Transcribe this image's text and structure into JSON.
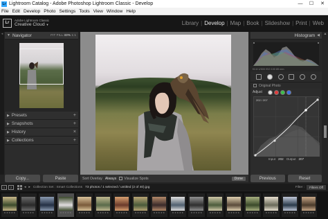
{
  "window": {
    "title": "Lightroom Catalog - Adobe Photoshop Lightroom Classic - Develop",
    "app_icon": "Lr",
    "controls": [
      "minimize-icon",
      "maximize-icon",
      "close-icon"
    ],
    "control_glyphs": [
      "—",
      "☐",
      "✕"
    ]
  },
  "menu": [
    "File",
    "Edit",
    "Develop",
    "Photo",
    "Settings",
    "Tools",
    "View",
    "Window",
    "Help"
  ],
  "identity": {
    "logo": "Lr",
    "line1": "Adobe Lightroom Classic",
    "line2": "Creative Cloud",
    "arrow": "▼"
  },
  "modules": {
    "items": [
      "Library",
      "Develop",
      "Map",
      "Book",
      "Slideshow",
      "Print",
      "Web"
    ],
    "active": "Develop",
    "separator": "|"
  },
  "navigator": {
    "title": "Navigator",
    "zoom_fit": "FIT",
    "zoom_fill": "FILL",
    "zoom_active": "33%",
    "zoom_ratio": "1:1"
  },
  "left_panels": [
    "Presets",
    "Snapshots",
    "History",
    "Collections"
  ],
  "left_buttons": {
    "copy": "Copy...",
    "paste": "Paste"
  },
  "toolbar": {
    "soft_proofing_label": "Sort Overlay",
    "overlay_value": "Always",
    "visualize_spots": "Visualize Spots",
    "done": "Done"
  },
  "histogram": {
    "title": "Histogram",
    "meta": "f/2.8   1/500   ISO 100   85 mm"
  },
  "tools": [
    "crop-icon",
    "spot-removal-icon",
    "red-eye-icon",
    "graduated-filter-icon",
    "radial-filter-icon",
    "brush-icon"
  ],
  "original_photo": "Original Photo",
  "tone_curve": {
    "label": "Adjust",
    "channels": [
      {
        "name": "rgb",
        "color": "#dddddd"
      },
      {
        "name": "red",
        "color": "#e03b3b"
      },
      {
        "name": "green",
        "color": "#3cc04a"
      },
      {
        "name": "blue",
        "color": "#3d6ee8"
      }
    ],
    "point_readout": "202 / 207",
    "input_label": "Input",
    "input_value": "202",
    "output_label": "Output",
    "output_value": "207"
  },
  "right_buttons": {
    "previous": "Previous",
    "reset": "Reset"
  },
  "filmstrip_bar": {
    "monitor1": "1",
    "monitor2": "2",
    "source": "Collection Set : Smart Collections",
    "count": "73 photos / 1 selected / untitled (2 of 40).jpg",
    "filter_label": "Filter :",
    "filter_value": "Filters Off"
  },
  "filmstrip": {
    "selected_index": 3,
    "thumbs": [
      {
        "c1": "#3b4a2b",
        "c2": "#c9b88a",
        "rating": "★★★★★"
      },
      {
        "c1": "#2a2a2a",
        "c2": "#6a6a6a",
        "rating": "★★★★★"
      },
      {
        "c1": "#243045",
        "c2": "#8a9ab0",
        "rating": "★★★★★"
      },
      {
        "c1": "#e0dde0",
        "c2": "#3c4a2c",
        "rating": "★★★★★"
      },
      {
        "c1": "#7a5a3a",
        "c2": "#d9c29a",
        "rating": "★★★★★"
      },
      {
        "c1": "#5a6a4a",
        "c2": "#c0b890",
        "rating": "★★★★★"
      },
      {
        "c1": "#6a3a2a",
        "c2": "#d8a070",
        "rating": "★★★★★"
      },
      {
        "c1": "#4a5a3a",
        "c2": "#b9a575",
        "rating": "★★★★★"
      },
      {
        "c1": "#3a2a2a",
        "c2": "#b48a6a",
        "rating": "★★★★★"
      },
      {
        "c1": "#506070",
        "c2": "#e0e0e0",
        "rating": "★★★★★"
      },
      {
        "c1": "#2f2f2f",
        "c2": "#909090",
        "rating": "★★★★★"
      },
      {
        "c1": "#4b5b3b",
        "c2": "#d0c8a8",
        "rating": "★★★★★"
      },
      {
        "c1": "#5a4a3a",
        "c2": "#e0d0b0",
        "rating": "★★★★★"
      },
      {
        "c1": "#3a4a2a",
        "c2": "#a8b080",
        "rating": "★★★★★"
      },
      {
        "c1": "#6a6a5a",
        "c2": "#e8e0d0",
        "rating": "★★★★★"
      },
      {
        "c1": "#2a3a4a",
        "c2": "#c0c8d8",
        "rating": "★★★★★"
      },
      {
        "c1": "#4a3a2a",
        "c2": "#c8a888",
        "rating": "★★★★★"
      }
    ]
  }
}
